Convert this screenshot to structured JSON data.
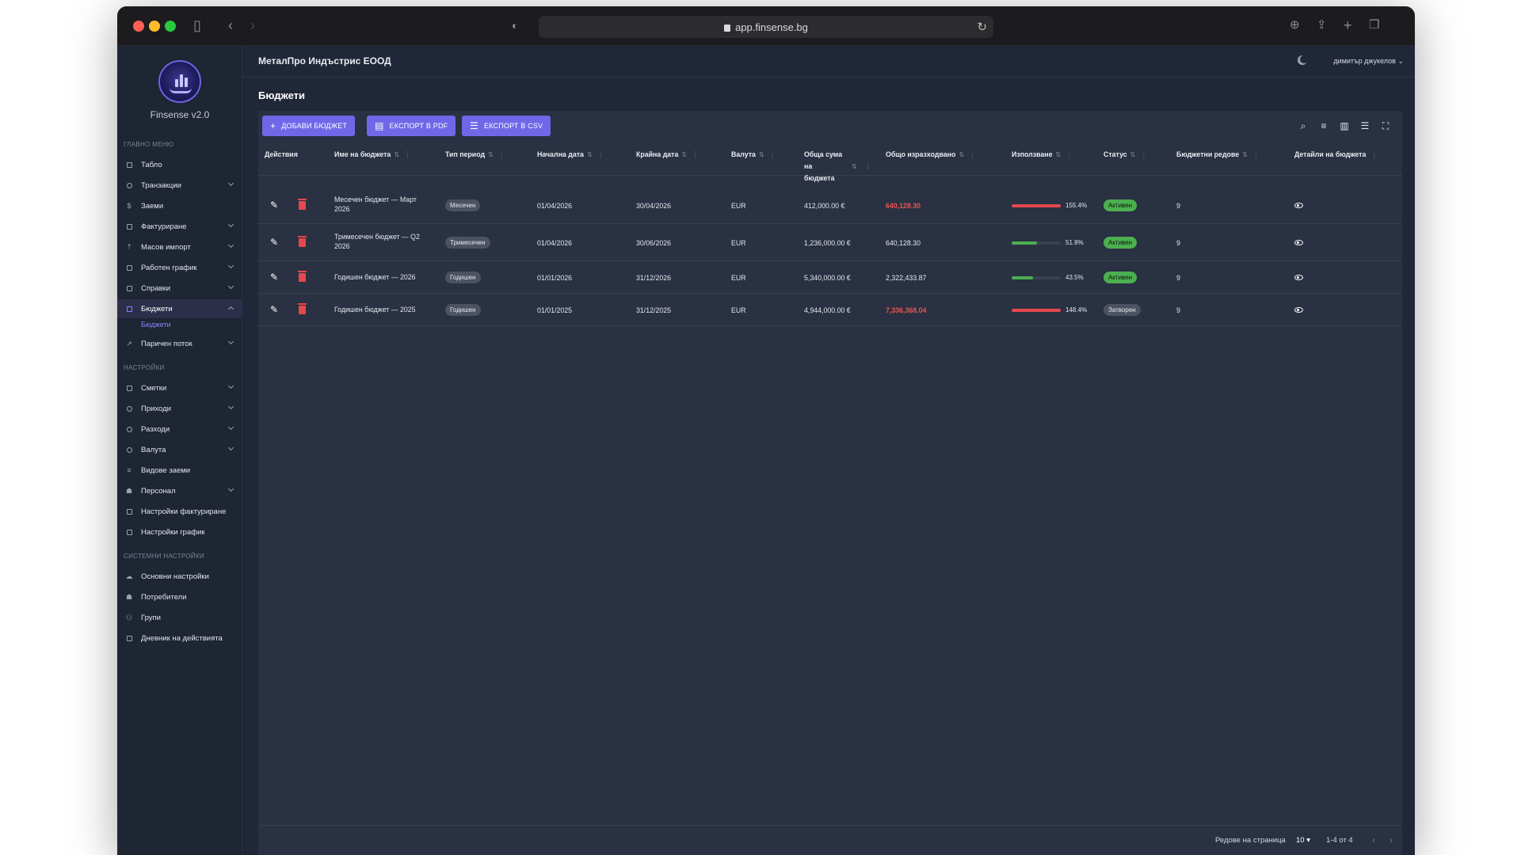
{
  "browser": {
    "url": "app.finsense.bg"
  },
  "app": {
    "brand": "Finsense v2.0",
    "company": "МеталПро Индъстрис ЕООД",
    "user": "димитър джукелов",
    "page_title": "Бюджети"
  },
  "sidebar": {
    "section_main": "ГЛАВНО МЕНЮ",
    "main_items": [
      {
        "label": "Табло"
      },
      {
        "label": "Транзакции"
      },
      {
        "label": "Заеми"
      },
      {
        "label": "Фактуриране"
      },
      {
        "label": "Масов импорт"
      },
      {
        "label": "Работен график"
      },
      {
        "label": "Справки"
      },
      {
        "label": "Бюджети"
      },
      {
        "label": "Паричен поток"
      }
    ],
    "active_sub": "Бюджети",
    "section_settings": "НАСТРОЙКИ",
    "settings_items": [
      {
        "label": "Сметки"
      },
      {
        "label": "Приходи"
      },
      {
        "label": "Разходи"
      },
      {
        "label": "Валута"
      },
      {
        "label": "Видове заеми"
      },
      {
        "label": "Персонал"
      },
      {
        "label": "Настройки фактуриране"
      },
      {
        "label": "Настройки график"
      }
    ],
    "section_system": "СИСТЕМНИ НАСТРОЙКИ",
    "system_items": [
      {
        "label": "Основни настройки"
      },
      {
        "label": "Потребители"
      },
      {
        "label": "Групи"
      },
      {
        "label": "Дневник на действията"
      }
    ]
  },
  "toolbar": {
    "add_label": "ДОБАВИ БЮДЖЕТ",
    "pdf_label": "ЕКСПОРТ В PDF",
    "csv_label": "ЕКСПОРТ В CSV"
  },
  "table": {
    "columns": {
      "actions": "Действия",
      "name": "Име на бюджета",
      "period": "Тип период",
      "start": "Начална дата",
      "end": "Крайна дата",
      "currency": "Валута",
      "total_l1": "Обща сума",
      "total_l2": "на",
      "total_l3": "бюджета",
      "spent": "Общо изразходвано",
      "usage": "Използване",
      "status": "Статус",
      "lines": "Бюджетни редове",
      "details": "Детайли на бюджета"
    },
    "rows": [
      {
        "name_l1": "Месечен бюджет — Март",
        "name_l2": "2026",
        "period": "Месечен",
        "start": "01/04/2026",
        "end": "30/04/2026",
        "currency": "EUR",
        "total": "412,000.00 €",
        "spent": "640,128.30",
        "usage": 155.4,
        "usage_label": "155.4%",
        "status": "Активен",
        "lines": "9"
      },
      {
        "name_l1": "Тримесечен бюджет — Q2",
        "name_l2": "2026",
        "period": "Тримесечен",
        "start": "01/04/2026",
        "end": "30/06/2026",
        "currency": "EUR",
        "total": "1,236,000.00 €",
        "spent": "640,128.30",
        "usage": 51.8,
        "usage_label": "51.8%",
        "status": "Активен",
        "lines": "9"
      },
      {
        "name_l1": "Годишен бюджет — 2026",
        "name_l2": "",
        "period": "Годишен",
        "start": "01/01/2026",
        "end": "31/12/2026",
        "currency": "EUR",
        "total": "5,340,000.00 €",
        "spent": "2,322,433.87",
        "usage": 43.5,
        "usage_label": "43.5%",
        "status": "Активен",
        "lines": "9"
      },
      {
        "name_l1": "Годишен бюджет — 2025",
        "name_l2": "",
        "period": "Годишен",
        "start": "01/01/2025",
        "end": "31/12/2025",
        "currency": "EUR",
        "total": "4,944,000.00 €",
        "spent": "7,336,368.04",
        "usage": 148.4,
        "usage_label": "148.4%",
        "status": "Затворен",
        "lines": "9"
      }
    ]
  },
  "footer": {
    "rows_per_page_label": "Редове на страница",
    "rows_per_page": "10",
    "range": "1-4 от 4"
  },
  "colors": {
    "accent": "#7067e8",
    "over_budget": "#e5484d",
    "ok": "#4caf50"
  }
}
